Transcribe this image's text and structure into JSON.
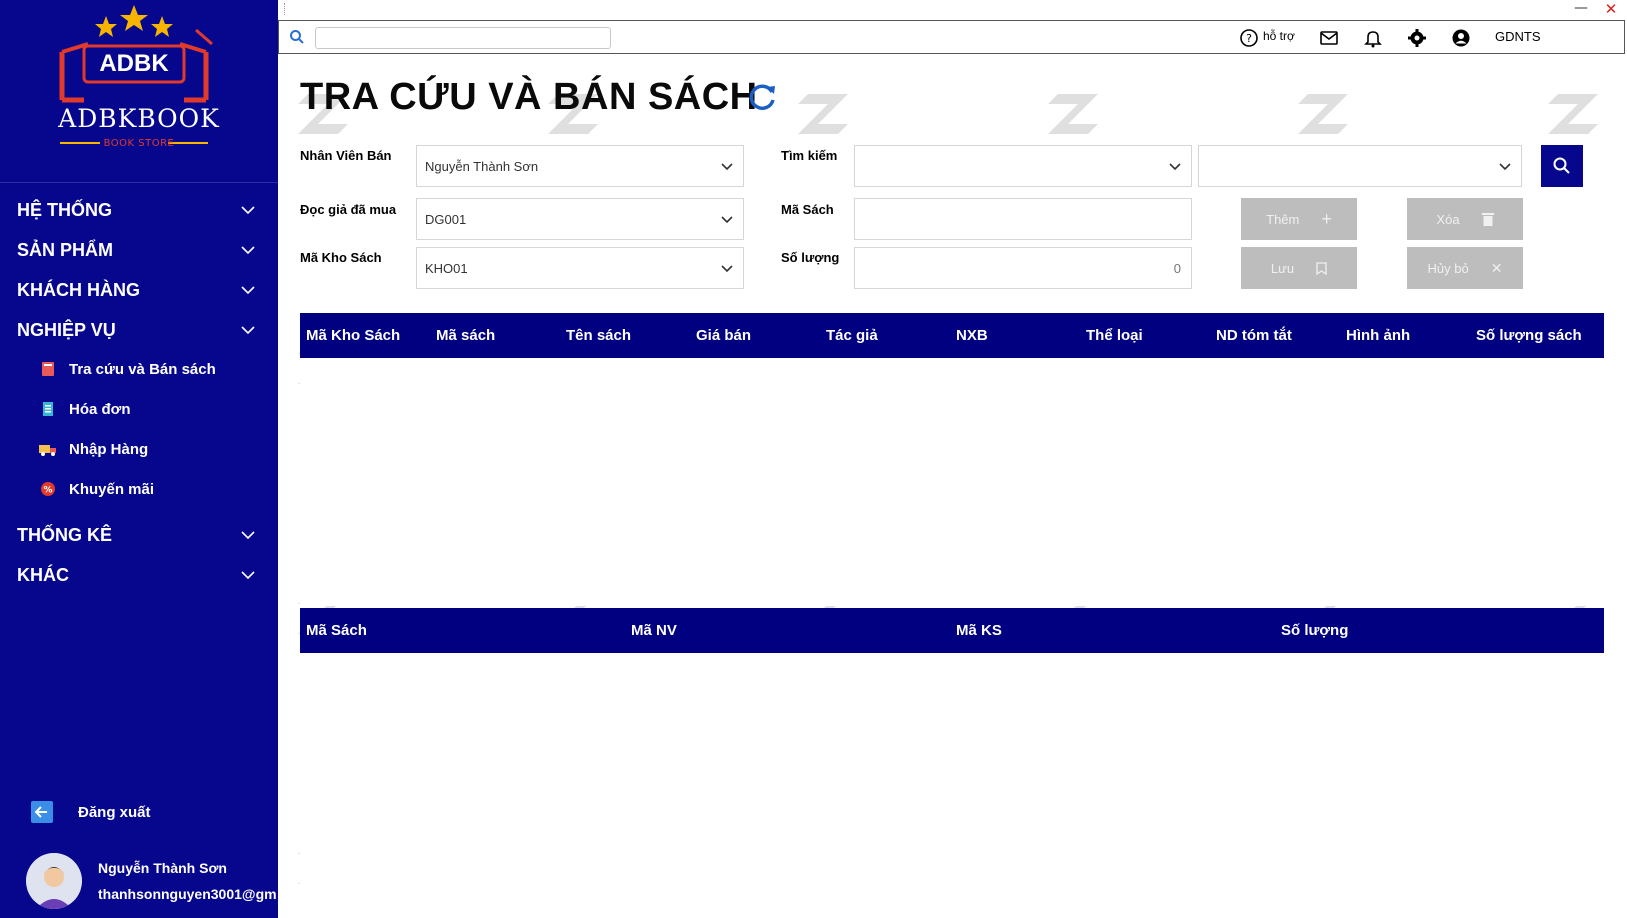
{
  "sidebar": {
    "logo_badge": "ADBK",
    "brand": "ADBKBOOK",
    "brand_sub": "BOOK STORE",
    "menu": [
      {
        "label": "HỆ THỐNG"
      },
      {
        "label": "SẢN PHẨM"
      },
      {
        "label": "KHÁCH HÀNG"
      },
      {
        "label": "NGHIỆP VỤ"
      },
      {
        "label": "THỐNG KÊ"
      },
      {
        "label": "KHÁC"
      }
    ],
    "submenu": [
      {
        "label": "Tra cứu và Bán sách",
        "icon": "book-icon"
      },
      {
        "label": "Hóa đơn",
        "icon": "invoice-icon"
      },
      {
        "label": "Nhập Hàng",
        "icon": "truck-icon"
      },
      {
        "label": "Khuyến mãi",
        "icon": "discount-icon"
      }
    ],
    "logout_label": "Đăng xuất",
    "user": {
      "name": "Nguyễn Thành Sơn",
      "email": "thanhsonnguyen3001@gm"
    }
  },
  "topbar": {
    "help_label": "hỗ trợ",
    "user_code": "GDNTS"
  },
  "page": {
    "title": "TRA CỨU VÀ BÁN SÁCH"
  },
  "form": {
    "employee_label": "Nhân Viên Bán",
    "employee_value": "Nguyễn Thành Sơn",
    "reader_label": "Đọc giả đã mua",
    "reader_value": "DG001",
    "warehouse_label": "Mã Kho Sách",
    "warehouse_value": "KHO01",
    "search_label": "Tìm kiếm",
    "book_code_label": "Mã Sách",
    "quantity_label": "Số lượng",
    "quantity_value": "0"
  },
  "buttons": {
    "add": "Thêm",
    "delete": "Xóa",
    "save": "Lưu",
    "cancel": "Hủy bỏ"
  },
  "table1": {
    "columns": [
      "Mã Kho Sách",
      "Mã sách",
      "Tên sách",
      "Giá bán",
      "Tác giả",
      "NXB",
      "Thể loại",
      "ND tóm tắt",
      "Hình ảnh",
      "Số lượng sách"
    ]
  },
  "table2": {
    "columns": [
      "Mã  Sách",
      "Mã NV",
      "Mã KS",
      "Số lượng"
    ]
  },
  "colors": {
    "sidebar_bg": "#07078e",
    "table_header": "#000080",
    "button_disabled": "#bdbdbd",
    "logo_red": "#e23a2a",
    "star": "#f7b500"
  }
}
